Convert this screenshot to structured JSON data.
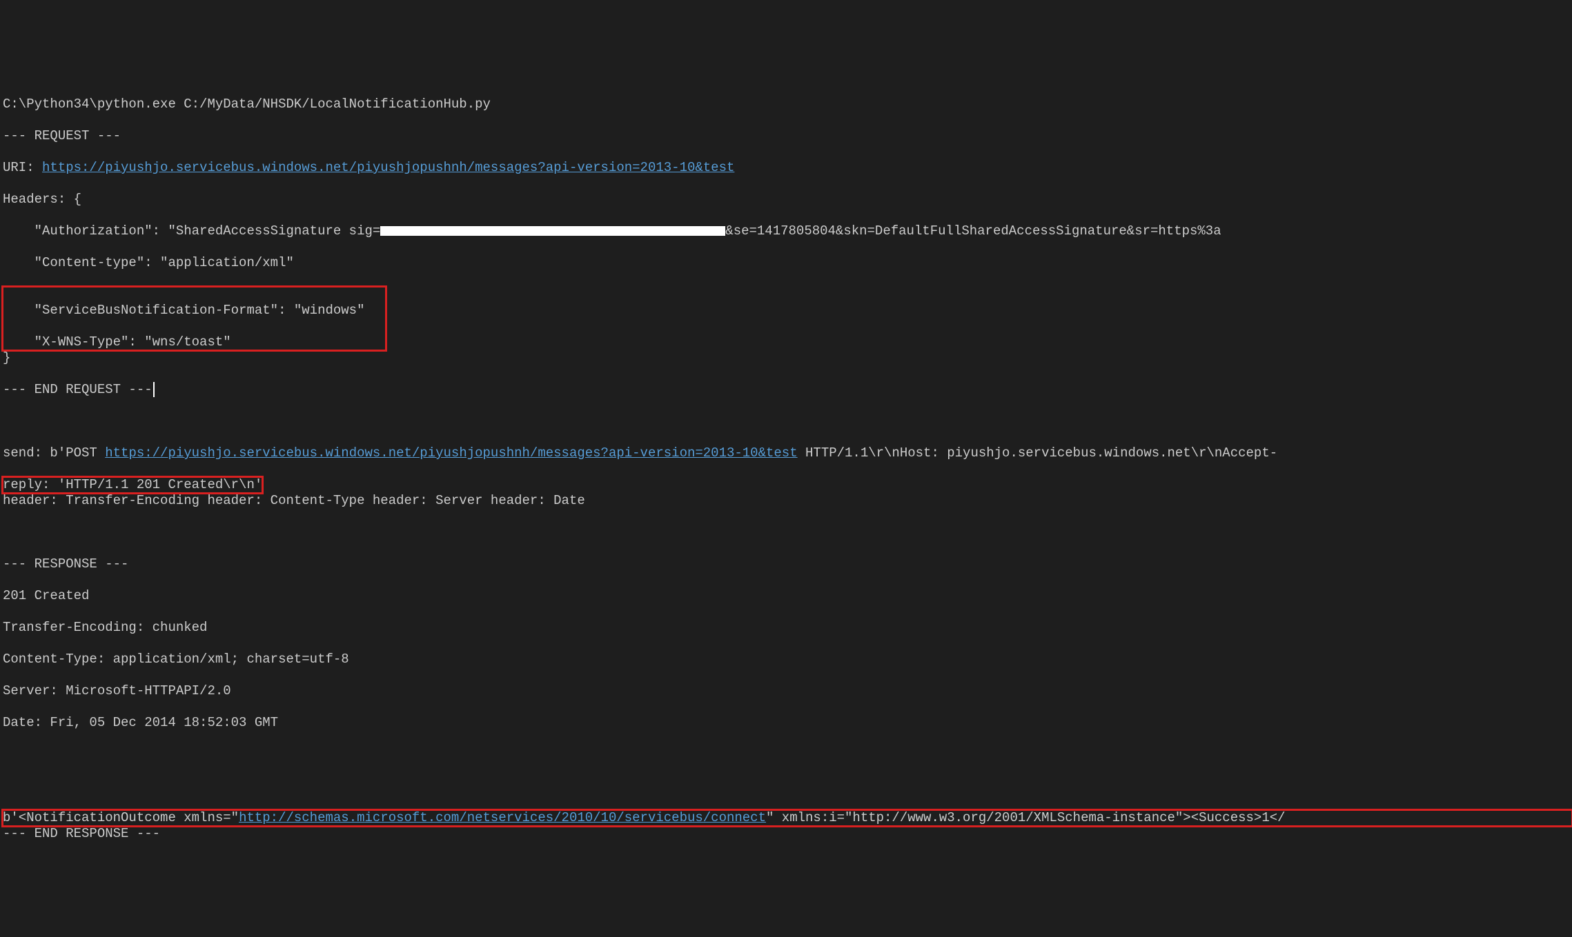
{
  "cmd": "C:\\Python34\\python.exe C:/MyData/NHSDK/LocalNotificationHub.py",
  "request": {
    "marker_start": "--- REQUEST ---",
    "uri_label": "URI: ",
    "uri_link": "https://piyushjo.servicebus.windows.net/piyushjopushnh/messages?api-version=2013-10&test",
    "headers_open": "Headers: {",
    "auth_line_pre": "    \"Authorization\": \"SharedAccessSignature sig=",
    "auth_line_post": "&se=1417805804&skn=DefaultFullSharedAccessSignature&sr=https%3a",
    "content_type": "    \"Content-type\": \"application/xml\"",
    "h_format": "    \"ServiceBusNotification-Format\": \"windows\"",
    "h_wns": "    \"X-WNS-Type\": \"wns/toast\"",
    "headers_close": "}",
    "marker_end": "--- END REQUEST ---"
  },
  "send": {
    "prefix": "send: b'POST ",
    "link": "https://piyushjo.servicebus.windows.net/piyushjopushnh/messages?api-version=2013-10&test",
    "suffix": " HTTP/1.1\\r\\nHost: piyushjo.servicebus.windows.net\\r\\nAccept-"
  },
  "reply": "reply: 'HTTP/1.1 201 Created\\r\\n'",
  "header_line": "header: Transfer-Encoding header: Content-Type header: Server header: Date",
  "response": {
    "marker_start": "--- RESPONSE ---",
    "status": "201 Created",
    "te": "Transfer-Encoding: chunked",
    "ct": "Content-Type: application/xml; charset=utf-8",
    "server": "Server: Microsoft-HTTPAPI/2.0",
    "date": "Date: Fri, 05 Dec 2014 18:52:03 GMT",
    "body_pre1": "b'<NotificationOutcome xmlns=\"",
    "body_link": "http://schemas.microsoft.com/netservices/2010/10/servicebus/connect",
    "body_post1": "\" xmlns:i=\"http://www.w3.org/2001/XMLSchema-instance\"><Success>1</",
    "marker_end": "--- END RESPONSE ---"
  }
}
